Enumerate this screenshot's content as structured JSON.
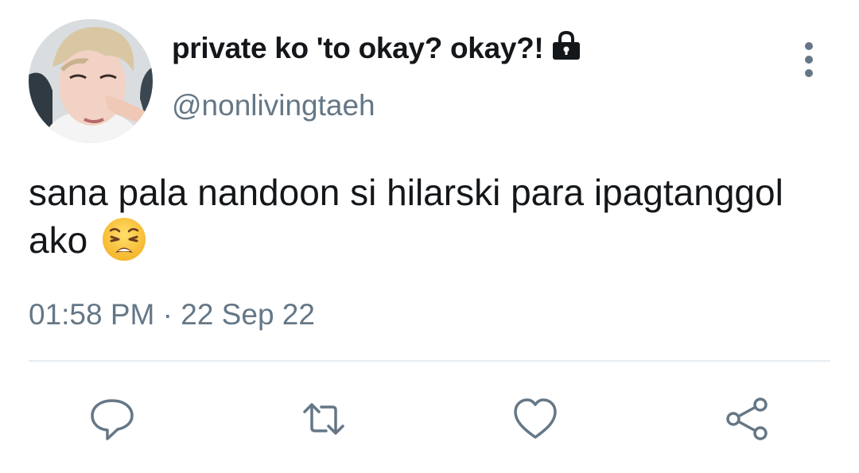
{
  "user": {
    "display_name": "private ko 'to okay? okay?!",
    "handle": "@nonlivingtaeh",
    "protected_icon": "lock-icon",
    "avatar": "avatar-photo"
  },
  "tweet": {
    "text": "sana pala nandoon si hilarski para ipagtanggol ako",
    "emoji": "weary-face",
    "timestamp": "01:58 PM · 22 Sep 22"
  },
  "menu_icon": "more-vertical-icon",
  "actions": [
    {
      "icon": "reply-icon"
    },
    {
      "icon": "retweet-icon"
    },
    {
      "icon": "like-icon"
    },
    {
      "icon": "share-icon"
    }
  ],
  "colors": {
    "primary_text": "#14171a",
    "secondary_text": "#657786",
    "divider": "#e6ecf0"
  }
}
